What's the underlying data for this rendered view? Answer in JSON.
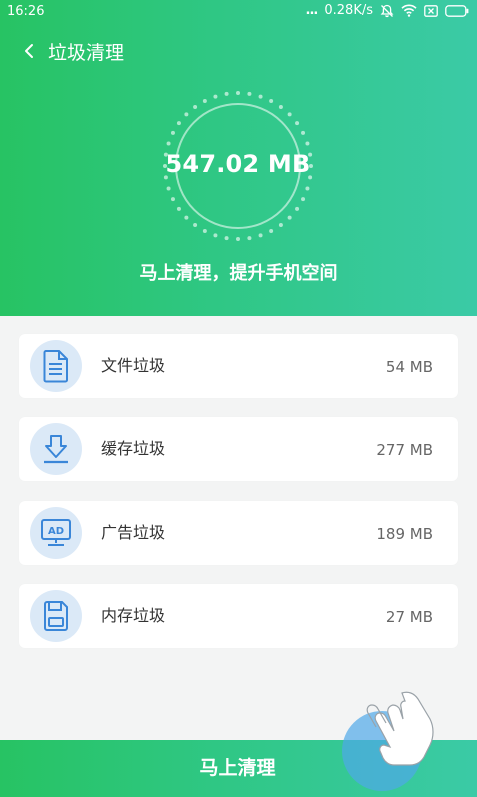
{
  "status_bar": {
    "time": "16:26",
    "dots": "...",
    "speed": "0.28K/s",
    "icons": [
      "bell-off-icon",
      "wifi-icon",
      "sim-icon",
      "battery-icon"
    ]
  },
  "header": {
    "title": "垃圾清理",
    "total_size": "547.02 MB",
    "subtitle": "马上清理，提升手机空间"
  },
  "items": [
    {
      "icon": "document-icon",
      "label": "文件垃圾",
      "size": "54 MB"
    },
    {
      "icon": "download-icon",
      "label": "缓存垃圾",
      "size": "277 MB"
    },
    {
      "icon": "ad-icon",
      "label": "广告垃圾",
      "size": "189 MB"
    },
    {
      "icon": "memory-card-icon",
      "label": "内存垃圾",
      "size": "27 MB"
    }
  ],
  "action": {
    "label": "马上清理"
  },
  "colors": {
    "gradient_start": "#27c363",
    "gradient_end": "#3bcaa6",
    "icon_blue": "#3a86d8",
    "icon_bg": "#dbe9f7"
  }
}
